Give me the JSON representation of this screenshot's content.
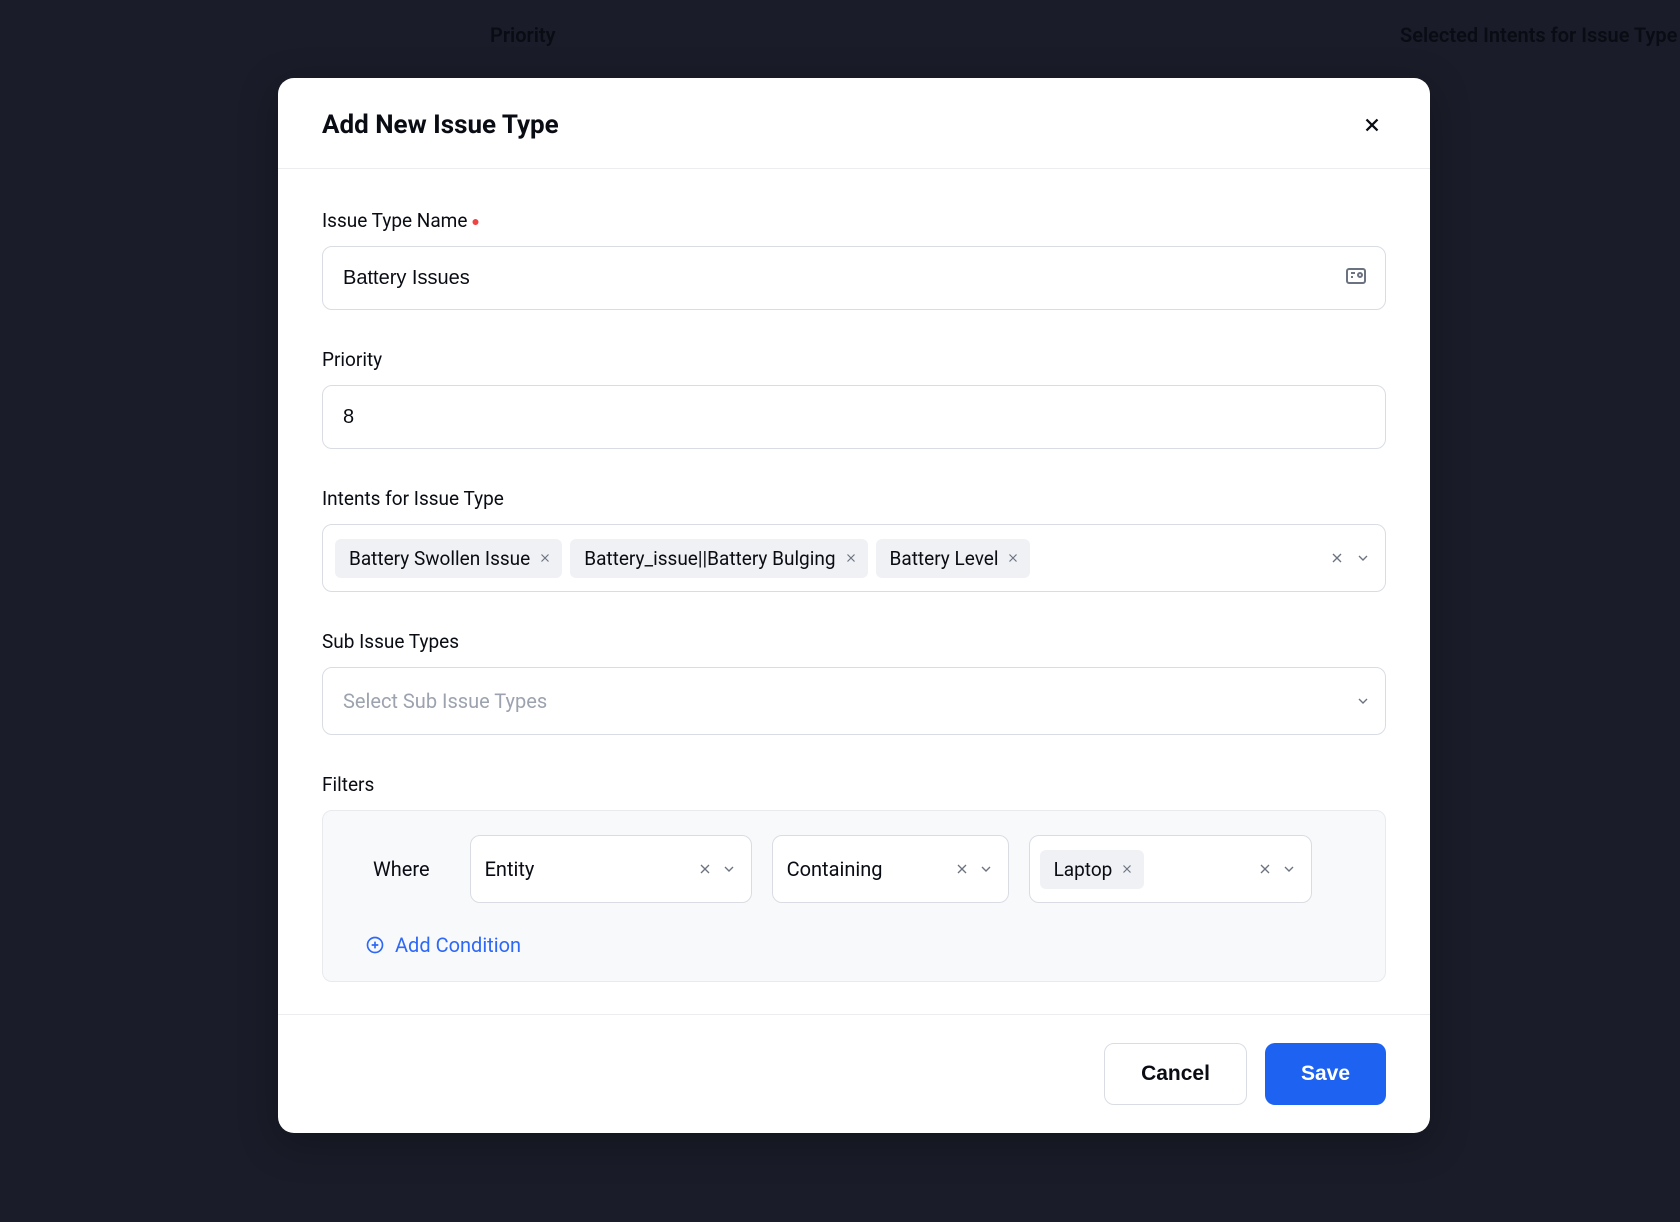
{
  "background": {
    "col1": "Priority",
    "col2": "Selected Intents for Issue Type"
  },
  "modal": {
    "title": "Add New Issue Type",
    "fields": {
      "name_label": "Issue Type Name",
      "name_value": "Battery Issues",
      "priority_label": "Priority",
      "priority_value": "8",
      "intents_label": "Intents for Issue Type",
      "intents": [
        "Battery Swollen Issue",
        "Battery_issue||Battery Bulging",
        "Battery Level"
      ],
      "sub_label": "Sub Issue Types",
      "sub_placeholder": "Select Sub Issue Types",
      "filters_label": "Filters",
      "filter_where": "Where",
      "filter_field": "Entity",
      "filter_op": "Containing",
      "filter_value": "Laptop",
      "add_condition": "Add Condition"
    },
    "footer": {
      "cancel": "Cancel",
      "save": "Save"
    }
  }
}
